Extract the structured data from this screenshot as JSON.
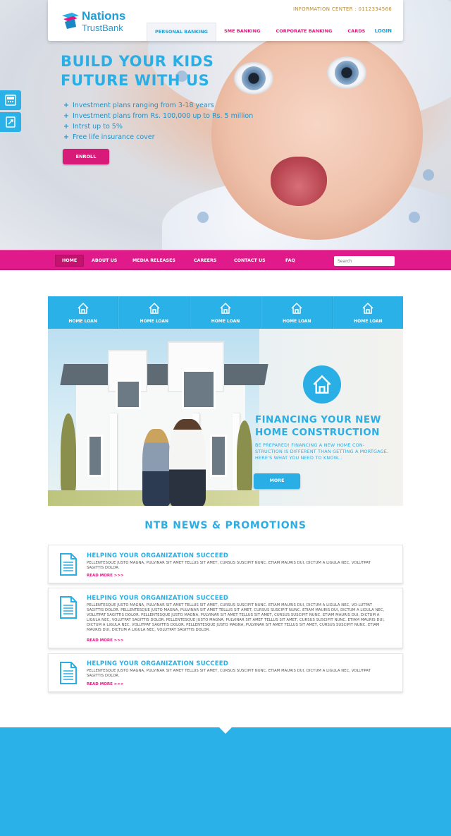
{
  "brand": {
    "line1": "Nations",
    "line2": "TrustBank",
    "colors": {
      "blue": "#29aee6",
      "magenta": "#e0167f",
      "gold": "#b98b3b"
    }
  },
  "header": {
    "info_center": "INFORMATION CENTER : 0112334566",
    "login": "LOGIN",
    "tabs": [
      {
        "label": "PERSONAL BANKING",
        "active": true
      },
      {
        "label": "SME BANKING"
      },
      {
        "label": "CORPORATE BANKING"
      },
      {
        "label": "CARDS"
      }
    ]
  },
  "side_tabs": [
    {
      "icon": "atm-icon"
    },
    {
      "icon": "exchange-icon"
    }
  ],
  "hero": {
    "title_line1": "BUILD YOUR KIDS",
    "title_line2": "FUTURE WITH US",
    "bullets": [
      "Investment plans ranging from 3-18 years",
      "Investment plans from Rs. 100,000 up to Rs. 5 million",
      "Intrst up to 5%",
      "Free life insurance cover"
    ],
    "cta": "ENROLL"
  },
  "main_nav": {
    "items": [
      {
        "label": "HOME",
        "active": true
      },
      {
        "label": "ABOUT US"
      },
      {
        "label": "MEDIA RELEASES"
      },
      {
        "label": "CAREERS"
      },
      {
        "label": "CONTACT US"
      },
      {
        "label": "FAQ"
      }
    ],
    "search_placeholder": "Search"
  },
  "services": [
    {
      "label": "HOME LOAN",
      "icon": "house-icon"
    },
    {
      "label": "HOME LOAN",
      "icon": "house-icon"
    },
    {
      "label": "HOME LOAN",
      "icon": "house-icon"
    },
    {
      "label": "HOME LOAN",
      "icon": "house-icon"
    },
    {
      "label": "HOME LOAN",
      "icon": "house-icon"
    }
  ],
  "feature": {
    "title_line1": "FINANCING YOUR NEW",
    "title_line2": "HOME CONSTRUCTION",
    "text": "BE PREPARED! FINANCING A NEW HOME CON-STRUCTION IS DIFFERENT THAN GETTING A MORTGAGE. HERE'S WHAT YOU NEED TO KNOW...",
    "cta": "MORE"
  },
  "news": {
    "title": "NTB NEWS & PROMOTIONS",
    "items": [
      {
        "title": "HELPING YOUR ORGANIZATION SUCCEED",
        "body": "PELLENTESQUE JUSTO MAGNA, PULVINAR SIT AMET TELLUS SIT AMET, CURSUS SUSCIPIT NUNC. ETIAM MAURIS DUI, DICTUM A LIGULA NEC, VOLUTPAT SAGITTIS DOLOR.",
        "link": "READ MORE >>>"
      },
      {
        "title": "HELPING YOUR ORGANIZATION SUCCEED",
        "body": "PELLENTESQUE JUSTO MAGNA, PULVINAR SIT AMET TELLUS SIT AMET, CURSUS SUSCIPIT NUNC. ETIAM MAURIS DUI, DICTUM A LIGULA NEC, VO-LUTPAT SAGITTIS DOLOR. PELLENTESQUE JUSTO MAGNA, PULVINAR SIT AMET TELLUS SIT AMET, CURSUS SUSCIPIT NUNC. ETIAM MAURIS DUI, DICTUM A LIGULA NEC, VOLUTPAT SAGITTIS DOLOR. PELLENTESQUE JUSTO MAGNA, PULVINAR SIT AMET TELLUS SIT AMET, CURSUS SUSCIPIT NUNC. ETIAM MAURIS DUI, DICTUM A LIGULA NEC, VOLUTPAT SAGITTIS DOLOR. PELLENTESQUE JUSTO MAGNA, PULVINAR SIT AMET TELLUS SIT AMET, CURSUS SUSCIPIT NUNC. ETIAM MAURIS DUI, DICTUM A LIGULA NEC, VOLUTPAT SAGITTIS DOLOR. PELLENTESQUE JUSTO MAGNA, PULVINAR SIT AMET TELLUS SIT AMET, CURSUS SUSCIPIT NUNC. ETIAM MAURIS DUI, DICTUM A LIGULA NEC, VOLUTPAT SAGITTIS DOLOR.",
        "link": "READ MORE >>>"
      },
      {
        "title": "HELPING YOUR ORGANIZATION SUCCEED",
        "body": "PELLENTESQUE JUSTO MAGNA, PULVINAR SIT AMET TELLUS SIT AMET, CURSUS SUSCIPIT NUNC. ETIAM MAURIS DUI, DICTUM A LIGULA NEC, VOLUTPAT SAGITTIS DOLOR.",
        "link": "READ MORE >>>"
      }
    ]
  }
}
